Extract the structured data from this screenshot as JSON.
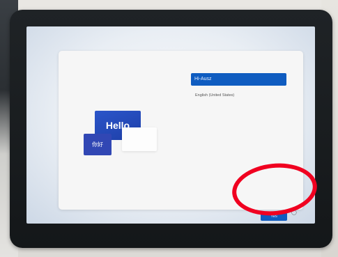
{
  "setup_card": {
    "selected_language": "Hi-Ausz",
    "language_option": "English (United States)",
    "yes_button_label": "Yes"
  },
  "illustration": {
    "hello_text": "Hello",
    "chinese_text": "你好"
  },
  "tray": {
    "wifi_icon": "wifi-icon",
    "accessibility_icon": "accessibility-icon"
  },
  "annotation": {
    "circle_color": "#f00020"
  }
}
